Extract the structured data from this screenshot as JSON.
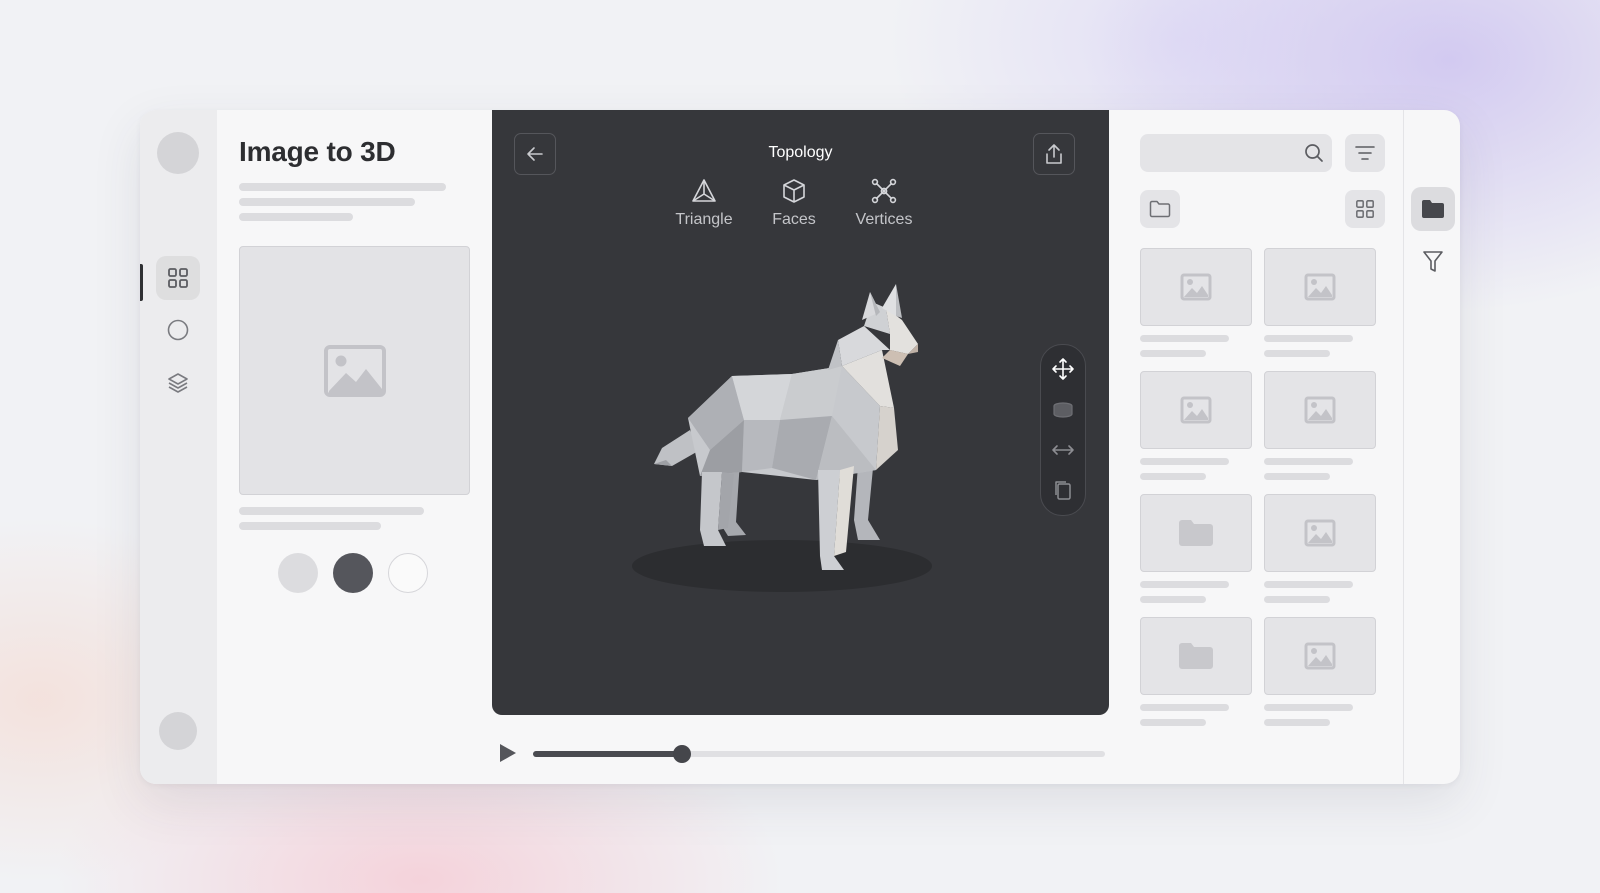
{
  "app": {
    "title": "Image to 3D"
  },
  "rail": {
    "items": [
      {
        "icon": "grid-icon",
        "active": true
      },
      {
        "icon": "circle-icon",
        "active": false
      },
      {
        "icon": "layers-icon",
        "active": false
      }
    ]
  },
  "viewer": {
    "title": "Topology",
    "modes": [
      {
        "label": "Triangle",
        "icon": "triangle-icon"
      },
      {
        "label": "Faces",
        "icon": "cube-icon"
      },
      {
        "label": "Vertices",
        "icon": "vertices-icon"
      }
    ],
    "tools": [
      "move-icon",
      "cylinder-icon",
      "resize-horizontal-icon",
      "copy-icon"
    ],
    "model": "low-poly-dog"
  },
  "player": {
    "progress": 0.26
  },
  "swatches": [
    "#dcdcdf",
    "#55565c",
    "#fafafa"
  ],
  "library": {
    "items": [
      {
        "type": "image"
      },
      {
        "type": "image"
      },
      {
        "type": "image"
      },
      {
        "type": "image"
      },
      {
        "type": "folder"
      },
      {
        "type": "image"
      },
      {
        "type": "folder"
      },
      {
        "type": "image"
      }
    ]
  },
  "right_rail": {
    "items": [
      "folder-icon",
      "filter-icon"
    ]
  },
  "colors": {
    "viewer_bg": "#36373b",
    "accent": "#45464b"
  }
}
